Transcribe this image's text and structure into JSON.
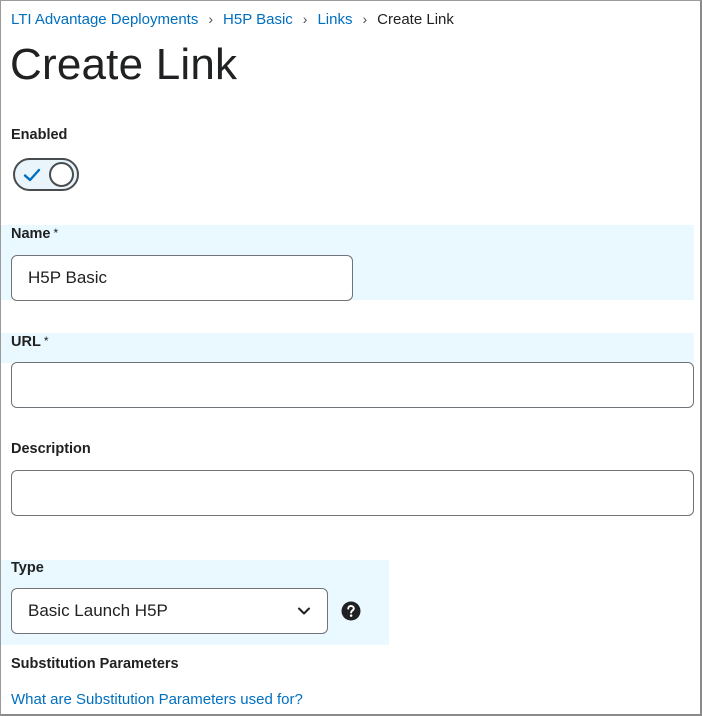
{
  "breadcrumb": {
    "items": [
      "LTI Advantage Deployments",
      "H5P Basic",
      "Links"
    ],
    "current": "Create Link",
    "separator": "›"
  },
  "page": {
    "title": "Create Link"
  },
  "enabled": {
    "label": "Enabled",
    "checked": true,
    "icon": "check-icon"
  },
  "name": {
    "label": "Name",
    "required_mark": "*",
    "value": "H5P Basic"
  },
  "url": {
    "label": "URL",
    "required_mark": "*",
    "value": ""
  },
  "description": {
    "label": "Description",
    "value": ""
  },
  "type": {
    "label": "Type",
    "selected": "Basic Launch H5P",
    "icon": "chevron-down-icon",
    "help_icon": "question-circle-icon"
  },
  "substitution": {
    "label": "Substitution Parameters",
    "help_link": "What are Substitution Parameters used for?"
  },
  "colors": {
    "link": "#006fbf",
    "highlight": "#eaf8ff",
    "text": "#202122",
    "border": "#6e7477",
    "accent": "#006fbf"
  }
}
